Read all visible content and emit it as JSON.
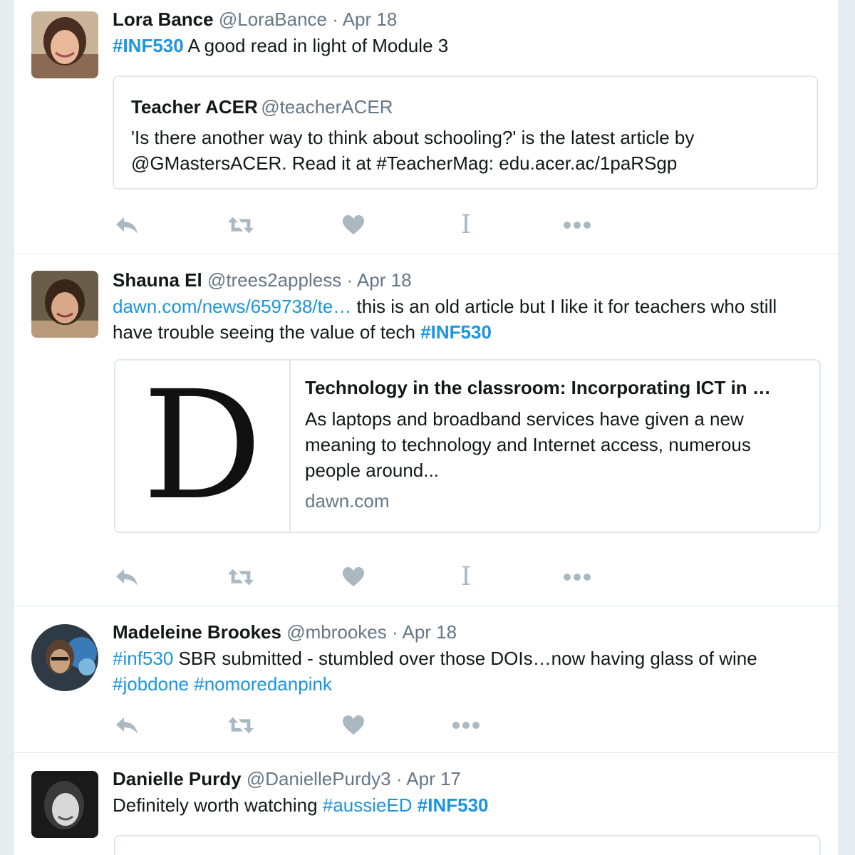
{
  "tweets": [
    {
      "name": "Lora Bance",
      "handle": "@LoraBance",
      "sep": "·",
      "date": "Apr 18",
      "hashtag": "#INF530",
      "text": " A good read in light of Module 3",
      "quote": {
        "name": "Teacher ACER",
        "handle": "@teacherACER",
        "text": "'Is there another way to think about schooling?' is the latest article by @GMastersACER. Read it at #TeacherMag: edu.acer.ac/1paRSgp"
      }
    },
    {
      "name": "Shauna El",
      "handle": "@trees2appless",
      "sep": "·",
      "date": "Apr 18",
      "link": "dawn.com/news/659738/te…",
      "text": " this is an old article but I like it for teachers who still have trouble seeing the value of tech ",
      "hashtag": "#INF530",
      "card": {
        "logo": "D",
        "title": "Technology in the classroom: Incorporating ICT in …",
        "description": "As laptops and broadband services have given a new meaning to technology and Internet access, numerous people around...",
        "domain": "dawn.com"
      }
    },
    {
      "name": "Madeleine Brookes",
      "handle": "@mbrookes",
      "sep": "·",
      "date": "Apr 18",
      "hashtag1": "#inf530",
      "text": " SBR submitted - stumbled over those DOIs…now having glass of wine ",
      "hashtag2": "#jobdone",
      "space": " ",
      "hashtag3": "#nomoredanpink"
    },
    {
      "name": "Danielle Purdy",
      "handle": "@DaniellePurdy3",
      "sep": "·",
      "date": "Apr 17",
      "text": "Definitely worth watching ",
      "hashtag1": "#aussieED",
      "space": " ",
      "hashtag2": "#INF530"
    }
  ],
  "actions": {
    "icons": [
      "reply-icon",
      "retweet-icon",
      "like-icon",
      "text-cursor-icon",
      "more-icon"
    ],
    "ibeam_glyph": "I"
  },
  "colors": {
    "link": "#1b95e0",
    "muted": "#657786",
    "action_icon": "#aab8c2"
  }
}
